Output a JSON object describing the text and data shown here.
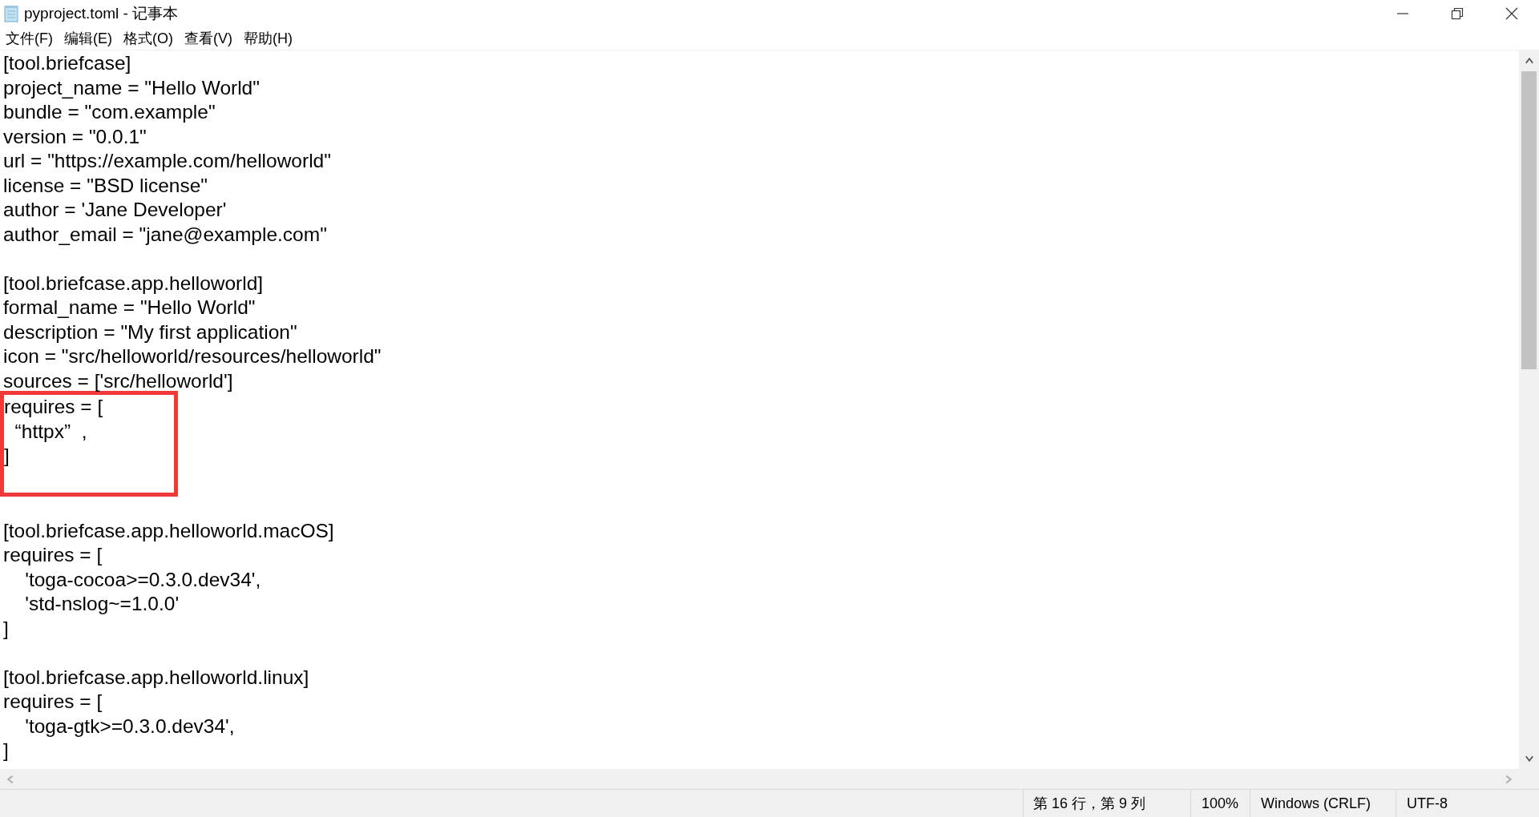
{
  "window": {
    "title": "pyproject.toml - 记事本"
  },
  "menu": [
    "文件(F)",
    "编辑(E)",
    "格式(O)",
    "查看(V)",
    "帮助(H)"
  ],
  "blocks": [
    {
      "kind": "plain",
      "lines": [
        {
          "kind": "text",
          "text": "[tool.briefcase]"
        },
        {
          "kind": "text",
          "text": "project_name = \"Hello World\""
        },
        {
          "kind": "text",
          "text": "bundle = \"com.example\""
        },
        {
          "kind": "text",
          "text": "version = \"0.0.1\""
        },
        {
          "kind": "text",
          "text": "url = \"https://example.com/helloworld\""
        },
        {
          "kind": "text",
          "text": "license = \"BSD license\""
        },
        {
          "kind": "text",
          "text": "author = 'Jane Developer'"
        },
        {
          "kind": "text",
          "text": "author_email = \"jane@example.com\""
        },
        {
          "kind": "blank"
        },
        {
          "kind": "text",
          "text": "[tool.briefcase.app.helloworld]"
        },
        {
          "kind": "text",
          "text": "formal_name = \"Hello World\""
        },
        {
          "kind": "text",
          "text": "description = \"My first application\""
        },
        {
          "kind": "text",
          "text": "icon = \"src/helloworld/resources/helloworld\""
        },
        {
          "kind": "text",
          "text": "sources = ['src/helloworld']"
        }
      ]
    },
    {
      "kind": "marked",
      "lines": [
        {
          "kind": "text",
          "text": "requires = ["
        },
        {
          "kind": "text",
          "text": "  “httpx”  ,"
        },
        {
          "kind": "text",
          "text": "]"
        },
        {
          "kind": "blank"
        }
      ]
    },
    {
      "kind": "plain",
      "lines": [
        {
          "kind": "blank"
        },
        {
          "kind": "text",
          "text": "[tool.briefcase.app.helloworld.macOS]"
        },
        {
          "kind": "text",
          "text": "requires = ["
        },
        {
          "kind": "text",
          "text": "    'toga-cocoa>=0.3.0.dev34',"
        },
        {
          "kind": "text",
          "text": "    'std-nslog~=1.0.0'"
        },
        {
          "kind": "text",
          "text": "]"
        },
        {
          "kind": "blank"
        },
        {
          "kind": "text",
          "text": "[tool.briefcase.app.helloworld.linux]"
        },
        {
          "kind": "text",
          "text": "requires = ["
        },
        {
          "kind": "text",
          "text": "    'toga-gtk>=0.3.0.dev34',"
        },
        {
          "kind": "text",
          "text": "]"
        }
      ]
    }
  ],
  "status_bar": [
    "第 16 行，第 9 列",
    "100%",
    "Windows (CRLF)",
    "UTF-8"
  ]
}
